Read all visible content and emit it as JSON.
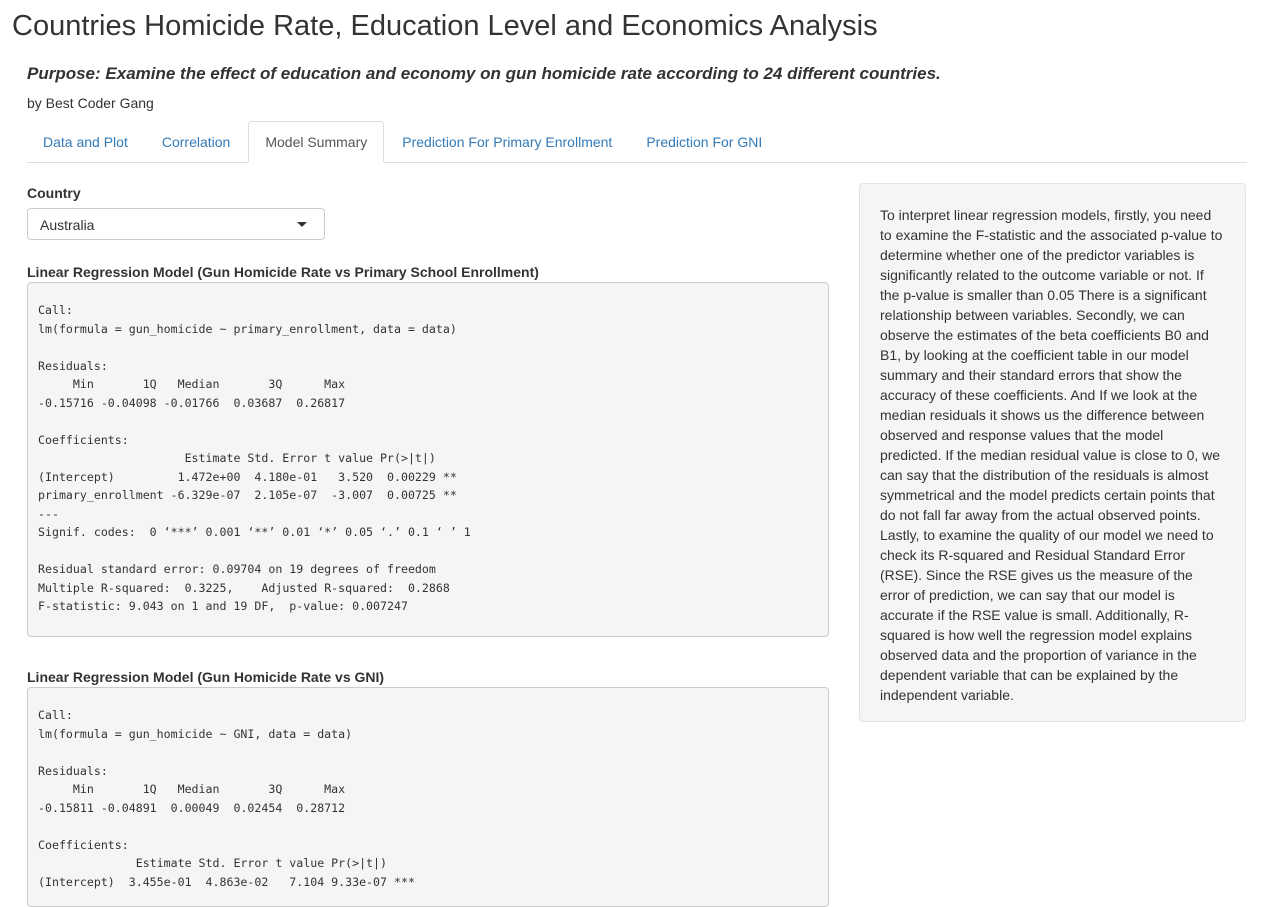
{
  "header": {
    "title": "Countries Homicide Rate, Education Level and Economics Analysis",
    "purpose": "Purpose: Examine the effect of education and economy on gun homicide rate according to 24 different countries.",
    "byline": "by Best Coder Gang"
  },
  "tabs": [
    {
      "label": "Data and Plot",
      "active": false
    },
    {
      "label": "Correlation",
      "active": false
    },
    {
      "label": "Model Summary",
      "active": true
    },
    {
      "label": "Prediction For Primary Enrollment",
      "active": false
    },
    {
      "label": "Prediction For GNI",
      "active": false
    }
  ],
  "colors": {
    "link": "#337ab7",
    "well_bg": "#f5f5f5",
    "code_bg": "#f5f5f5"
  },
  "country": {
    "label": "Country",
    "selected": "Australia"
  },
  "model1": {
    "title": "Linear Regression Model (Gun Homicide Rate vs Primary School Enrollment)",
    "output": "Call:\nlm(formula = gun_homicide ~ primary_enrollment, data = data)\n\nResiduals:\n     Min       1Q   Median       3Q      Max \n-0.15716 -0.04098 -0.01766  0.03687  0.26817 \n\nCoefficients:\n                     Estimate Std. Error t value Pr(>|t|)   \n(Intercept)         1.472e+00  4.180e-01   3.520  0.00229 **\nprimary_enrollment -6.329e-07  2.105e-07  -3.007  0.00725 **\n---\nSignif. codes:  0 ‘***’ 0.001 ‘**’ 0.01 ‘*’ 0.05 ‘.’ 0.1 ‘ ’ 1\n\nResidual standard error: 0.09704 on 19 degrees of freedom\nMultiple R-squared:  0.3225,\tAdjusted R-squared:  0.2868 \nF-statistic: 9.043 on 1 and 19 DF,  p-value: 0.007247"
  },
  "model2": {
    "title": "Linear Regression Model (Gun Homicide Rate vs GNI)",
    "output": "Call:\nlm(formula = gun_homicide ~ GNI, data = data)\n\nResiduals:\n     Min       1Q   Median       3Q      Max \n-0.15811 -0.04891  0.00049  0.02454  0.28712 \n\nCoefficients:\n              Estimate Std. Error t value Pr(>|t|)    \n(Intercept)  3.455e-01  4.863e-02   7.104 9.33e-07 ***"
  },
  "interpretation": "To interpret linear regression models, firstly, you need to examine the F-statistic and the associated p-value to determine whether one of the predictor variables is significantly related to the outcome variable or not. If the p-value is smaller than 0.05 There is a significant relationship between variables. Secondly, we can observe the estimates of the beta coefficients B0 and B1, by looking at the coefficient table in our model summary and their standard errors that show the accuracy of these coefficients. And If we look at the median residuals it shows us the difference between observed and response values that the model predicted. If the median residual value is close to 0, we can say that the distribution of the residuals is almost symmetrical and the model predicts certain points that do not fall far away from the actual observed points. Lastly, to examine the quality of our model we need to check its R-squared and Residual Standard Error (RSE). Since the RSE gives us the measure of the error of prediction, we can say that our model is accurate if the RSE value is small. Additionally, R-squared is how well the regression model explains observed data and the proportion of variance in the dependent variable that can be explained by the independent variable."
}
